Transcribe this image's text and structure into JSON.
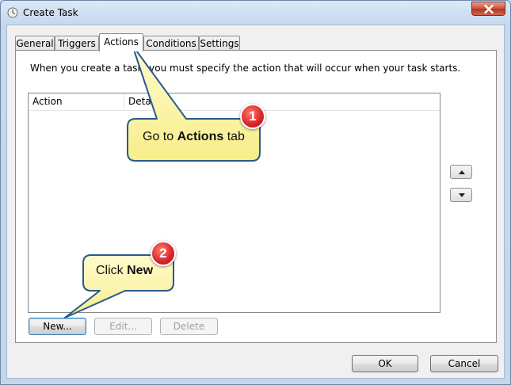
{
  "window": {
    "title": "Create Task",
    "title_icon": "clock-icon"
  },
  "tabs": [
    {
      "label": "General"
    },
    {
      "label": "Triggers"
    },
    {
      "label": "Actions"
    },
    {
      "label": "Conditions"
    },
    {
      "label": "Settings"
    }
  ],
  "active_tab": "Actions",
  "actions_panel": {
    "intro": "When you create a task, you must specify the action that will occur when your task starts.",
    "columns": [
      "Action",
      "Details"
    ],
    "rows": [],
    "move_up_icon": "triangle-up-icon",
    "move_down_icon": "triangle-down-icon"
  },
  "panel_buttons": {
    "new": "New...",
    "edit": "Edit...",
    "delete": "Delete"
  },
  "footer": {
    "ok": "OK",
    "cancel": "Cancel"
  },
  "annotations": [
    {
      "number": "1",
      "text_prefix": "Go to ",
      "text_bold": "Actions",
      "text_suffix": " tab"
    },
    {
      "number": "2",
      "text_prefix": "Click ",
      "text_bold": "New",
      "text_suffix": ""
    }
  ],
  "colors": {
    "callout_fill": "#fdf7b0",
    "callout_border": "#2a5a8c",
    "badge": "#d8232a"
  }
}
